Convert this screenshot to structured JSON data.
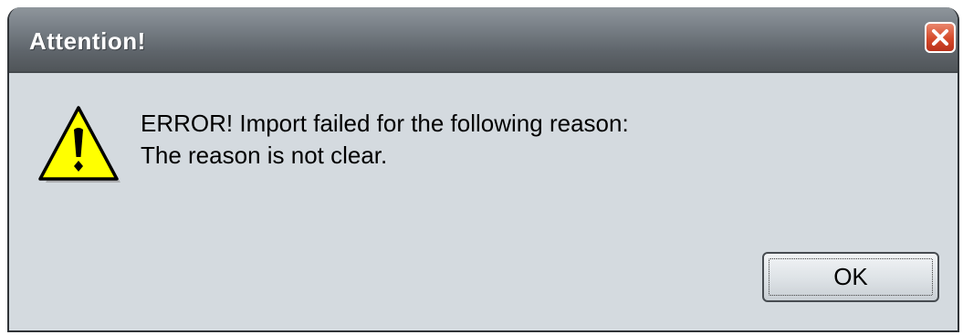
{
  "window": {
    "title": "Attention!",
    "close_icon": "close-x-icon"
  },
  "message": {
    "icon": "warning-triangle-icon",
    "line1": "ERROR! Import failed for the following reason:",
    "line2": "The reason is not clear."
  },
  "buttons": {
    "ok_label": "OK"
  },
  "colors": {
    "dialog_background": "#d4dadf",
    "titlebar": "#6a7177",
    "close_button": "#d54a2a",
    "warning_yellow": "#ffff00"
  }
}
